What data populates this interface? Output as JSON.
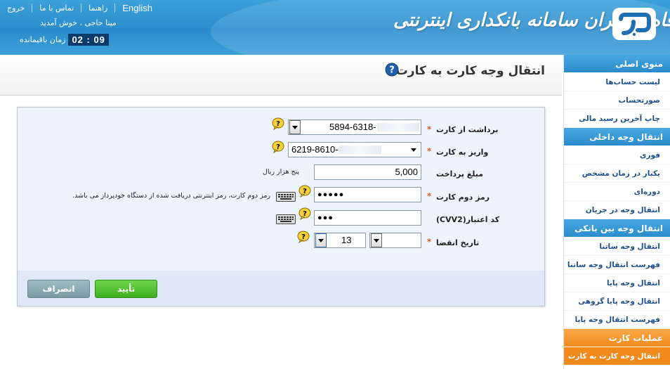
{
  "header": {
    "nav": {
      "english": "English",
      "help": "راهنما",
      "contact": "تماس با ما",
      "logout": "خروج"
    },
    "welcome": "مینا حاجی ، خوش آمدید",
    "timer": "02 : 09",
    "remaining_label": "زمان باقیمانده",
    "brand_name": "بانک رفاه کارگران سامانه بانکداری اینترنتی"
  },
  "page": {
    "title": "انتقال وجه کارت به کارت"
  },
  "form": {
    "from_card": {
      "label": "برداشت از کارت",
      "value_prefix": "5894-6318-"
    },
    "to_card": {
      "label": "واریز به کارت",
      "value_prefix": "6219-8610-"
    },
    "amount": {
      "label": "مبلغ پرداخت",
      "value": "5,000",
      "words": "پنج هزار ریال"
    },
    "pin2": {
      "label": "رمز دوم کارت",
      "value": "●●●●●",
      "hint": "رمز دوم کارت، رمز اینترنتی دریافت شده از دستگاه خودپرداز می باشد."
    },
    "cvv2": {
      "label": "کد اعتبار(CVV2)",
      "value": "●●●"
    },
    "expiry": {
      "label": "تاریخ انقضا",
      "year": "13",
      "month": ""
    },
    "required_mark": "*",
    "confirm": "تأیید",
    "cancel": "انصراف"
  },
  "sidebar": {
    "sections": [
      {
        "title": "منوی اصلی",
        "items": [
          "لیست حساب‌ها",
          "صورتحساب",
          "چاپ آخرین رسید مالی"
        ]
      },
      {
        "title": "انتقال وجه داخلی",
        "items": [
          "فوری",
          "یکبار در زمان مشخص",
          "دوره‌ای",
          "انتقال وجه در جریان"
        ]
      },
      {
        "title": "انتقال وجه بین بانکی",
        "items": [
          "انتقال وجه ساتنا",
          "فهرست انتقال وجه ساتنا",
          "انتقال وجه پایا",
          "انتقال وجه پایا گروهی",
          "فهرست انتقال وجه پایا"
        ]
      },
      {
        "title": "عملیات کارت",
        "items": [
          "انتقال وجه کارت به کارت"
        ]
      }
    ]
  },
  "colors": {
    "header": "#2a8ccc",
    "accent_orange": "#f18a1d",
    "confirm_green": "#3fae22"
  }
}
